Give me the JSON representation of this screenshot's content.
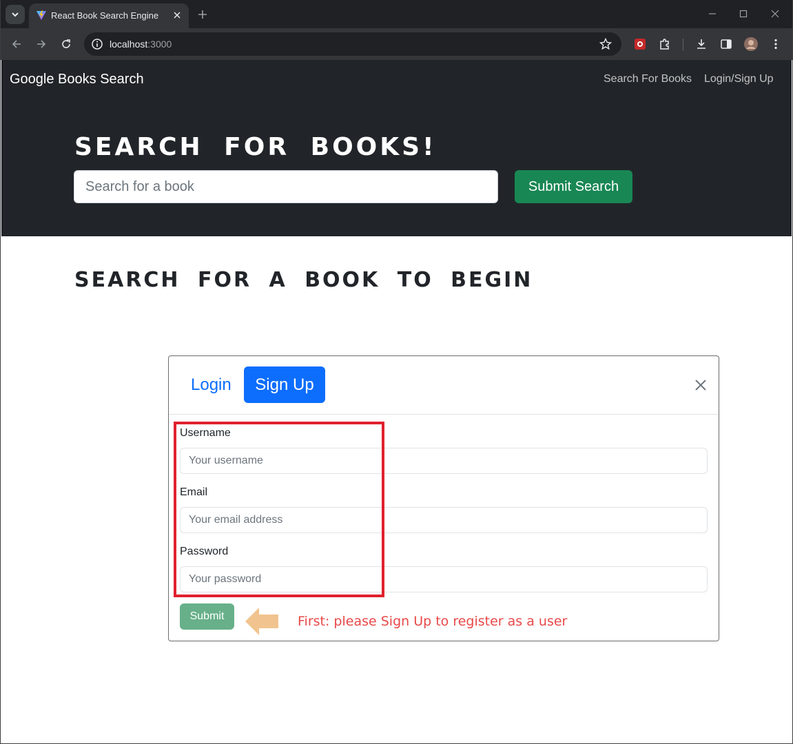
{
  "browser": {
    "tab_title": "React Book Search Engine",
    "url_host": "localhost",
    "url_port": ":3000",
    "icons": [
      "tab-list-icon",
      "vite-favicon",
      "close-icon",
      "plus-icon",
      "minimize-icon",
      "maximize-icon",
      "close-icon",
      "back-arrow-icon",
      "forward-arrow-icon",
      "reload-icon",
      "info-icon",
      "star-icon",
      "extension-red-icon",
      "puzzle-icon",
      "download-icon",
      "side-panel-icon",
      "profile-avatar",
      "more-vert-icon"
    ]
  },
  "navbar": {
    "brand": "Google Books Search",
    "links": [
      "Search For Books",
      "Login/Sign Up"
    ]
  },
  "hero": {
    "title": "SEARCH FOR BOOKS!",
    "search_placeholder": "Search for a book",
    "submit_label": "Submit Search"
  },
  "results": {
    "title": "SEARCH FOR A BOOK TO BEGIN"
  },
  "modal": {
    "tabs": [
      {
        "label": "Login",
        "active": false
      },
      {
        "label": "Sign Up",
        "active": true
      }
    ],
    "fields": [
      {
        "label": "Username",
        "placeholder": "Your username"
      },
      {
        "label": "Email",
        "placeholder": "Your email address"
      },
      {
        "label": "Password",
        "placeholder": "Your password"
      }
    ],
    "submit_label": "Submit"
  },
  "annotation": {
    "note": "First: please Sign Up to register as a user",
    "box_color": "#e0212e",
    "arrow_color": "#f1c48f",
    "note_color": "#e94848"
  },
  "colors": {
    "dark": "#212529",
    "primary": "#0d6efd",
    "success": "#198754",
    "submit_disabled": "#67b08a"
  }
}
